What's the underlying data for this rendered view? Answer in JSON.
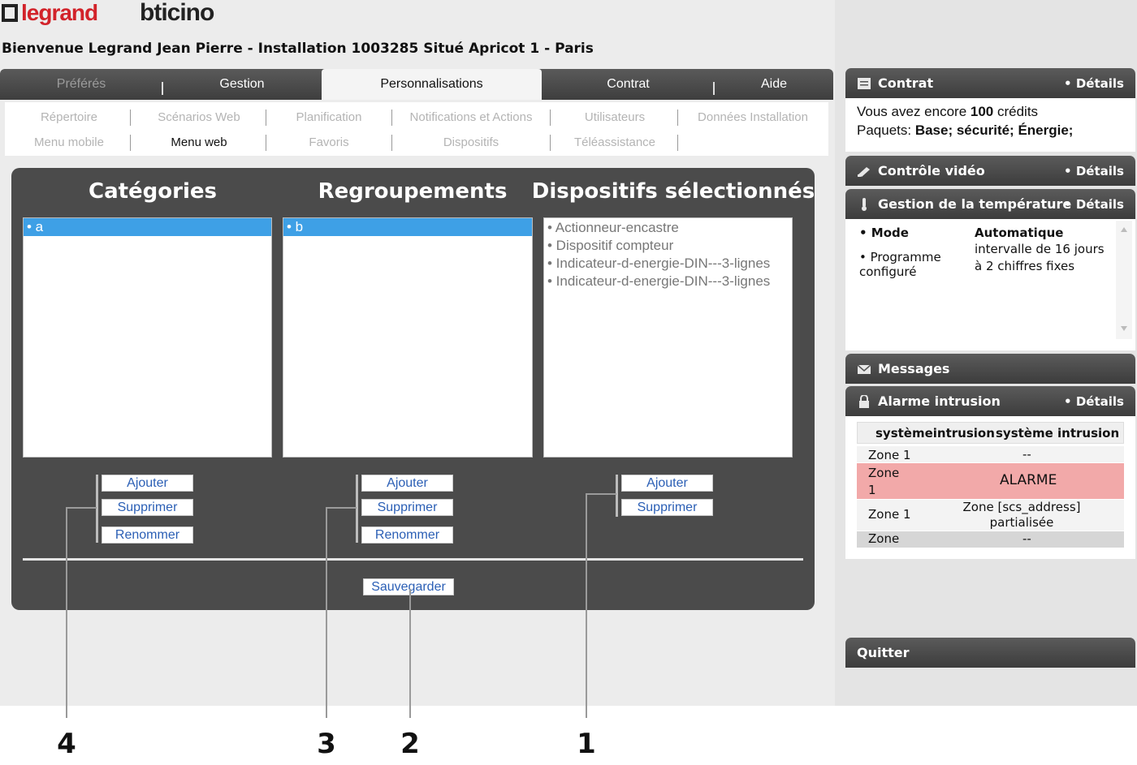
{
  "header": {
    "logo_legrand": "legrand",
    "logo_bticino": "bticino",
    "welcome": "Bienvenue Legrand Jean Pierre - Installation 1003285 Situé Apricot 1 - Paris"
  },
  "tabs": [
    {
      "label": "Préférés",
      "state": "disabled"
    },
    {
      "label": "Gestion",
      "state": "normal"
    },
    {
      "label": "Personnalisations",
      "state": "active"
    },
    {
      "label": "Contrat",
      "state": "normal"
    },
    {
      "label": "Aide",
      "state": "normal"
    }
  ],
  "submenu": {
    "row1": [
      "Répertoire",
      "Scénarios Web",
      "Planification",
      "Notifications et Actions",
      "Utilisateurs",
      "Données Installation"
    ],
    "row2": [
      "Menu mobile",
      "Menu web",
      "Favoris",
      "Dispositifs",
      "Téléassistance"
    ],
    "active": "Menu web"
  },
  "editor": {
    "categories": {
      "title": "Catégories",
      "items": [
        "• a"
      ]
    },
    "groups": {
      "title": "Regroupements",
      "items": [
        "• b"
      ]
    },
    "devices": {
      "title": "Dispositifs sélectionnés",
      "items": [
        "• Actionneur-encastre",
        "• Dispositif compteur",
        "• Indicateur-d-energie-DIN---3-lignes",
        "• Indicateur-d-energie-DIN---3-lignes"
      ]
    },
    "buttons": {
      "add": "Ajouter",
      "delete": "Supprimer",
      "rename": "Renommer",
      "save": "Sauvegarder"
    }
  },
  "callouts": [
    "4",
    "3",
    "2",
    "1"
  ],
  "sidebar": {
    "details_label": "• Détails",
    "contrat": {
      "title": "Contrat",
      "line1_prefix": "Vous avez encore ",
      "credits": "100",
      "line1_suffix": " crédits",
      "line2_prefix": "Paquets: ",
      "packages": "Base; sécurité; Énergie;"
    },
    "video": {
      "title": "Contrôle vidéo"
    },
    "temperature": {
      "title": "Gestion de la température",
      "mode_label": "• Mode",
      "mode_value": "Automatique",
      "program_label_1": "• Programme",
      "program_label_2": "configuré",
      "program_value": "intervalle de 16 jours à 2 chiffres fixes"
    },
    "messages": {
      "title": "Messages"
    },
    "alarm": {
      "title": "Alarme intrusion",
      "col1": "systèmeintrusion",
      "col2": "système intrusion",
      "rows": [
        {
          "zone": "Zone 1",
          "status": "--"
        },
        {
          "zone": "Zone 1",
          "status": "ALARME"
        },
        {
          "zone": "Zone 1",
          "status": "Zone [scs_address] partialisée"
        },
        {
          "zone": "Zone",
          "status": "--"
        }
      ]
    },
    "quit": "Quitter"
  },
  "colors": {
    "tab_bar": "#4a4a4a",
    "selected_item": "#3ea0e6",
    "link_blue": "#2b5fb5",
    "alarm_row": "#f2a9a9",
    "legrand_red": "#d2232a",
    "bticino_orange": "#e0761f"
  }
}
